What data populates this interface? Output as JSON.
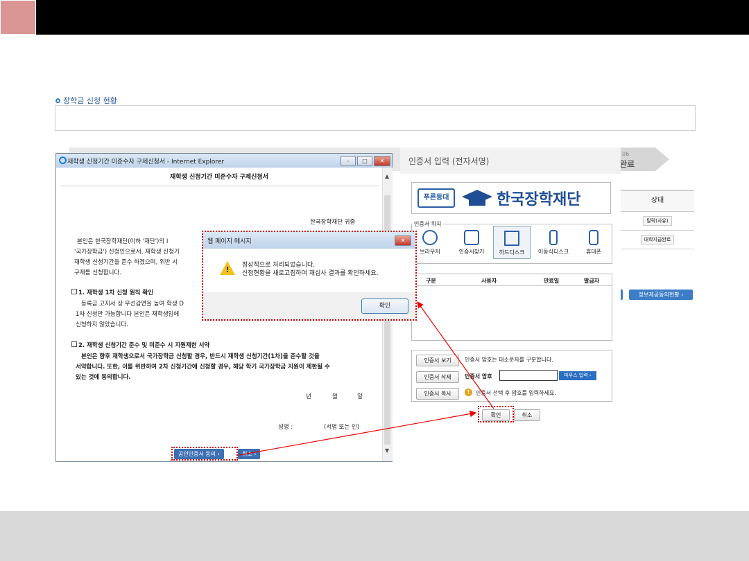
{
  "section_title": "장학금 신청 현황",
  "steps": {
    "step6_num": "06",
    "step6_label": "완료"
  },
  "right_table": {
    "header": "상태",
    "rows": [
      "탈락(사유)",
      "대학지급완료"
    ],
    "link_button": "정보제공동의현황"
  },
  "ie_window": {
    "title": "재학생 신청기간 미준수자 구제신청서 - Internet Explorer",
    "doc_title": "재학생 신청기간 미준수자 구제신청서",
    "recipient": "한국장학재단 귀중",
    "intro_lines": [
      "본인은  한국장학재단(이하  '재단')의   I",
      "'국가장학금') 신청인으로서,  재학생 신청기",
      "재학생 신청기간을 준수 하겠으며, 위반 시 ",
      "구제를 신청합니다."
    ],
    "section1_title": "1. 재학생 1차 신청 원칙 확인",
    "section1_lines": [
      "등록금 고지서 상 우선감면을 높여 학생 D",
      "1차 신청만 가능합니다  본인은 재학생임에",
      "신청하지 않았습니다."
    ],
    "section2_title": "2. 재학생 신청기간 준수 및 미준수 시 지원제한 서약",
    "section2_lines": [
      "본인은 향후 재학생으로서 국가장학금 신청할 경우, 반드시 재학생 신청기간(1차)을 준수할 것을",
      "서약합니다. 또한, 이를 위반하여 2차 신청기간에 신청할 경우, 해당 학기 국가장학금 지원이 제한될 수",
      "있는 것에 동의합니다."
    ],
    "date_year": "년",
    "date_month": "월",
    "date_day": "일",
    "name_label": "성명 :",
    "sign_label": "(서명 또는 인)",
    "btn_cert": "공인인증서 동의",
    "btn_cancel": "취소"
  },
  "message_box": {
    "title": "웹 페이지 메시지",
    "line1": "정상적으로 처리되었습니다.",
    "line2": "신청현황을 새로고침하여 재심사 결과를 확인하세요.",
    "ok": "확인"
  },
  "cert_panel": {
    "heading": "인증서 입력 (전자서명)",
    "logo_badge": "푸른등대",
    "logo_name": "한국장학재단",
    "location_label": "인증서 위치",
    "locations": [
      "브라우저",
      "인증서찾기",
      "하드디스크",
      "이동식디스크",
      "휴대폰"
    ],
    "table_headers": [
      "구분",
      "사용자",
      "만료일",
      "발급자"
    ],
    "btn_view": "인증서 보기",
    "btn_delete": "인증서 삭제",
    "btn_copy": "인증서 복사",
    "case_note": "인증서 암호는 대소문자를 구분합니다.",
    "pw_label": "인증서 암호",
    "mouse_input": "마우스 입력",
    "hint": "인증서 선택 후 암호를 입력하세요.",
    "confirm": "확인",
    "cancel": "취소"
  }
}
